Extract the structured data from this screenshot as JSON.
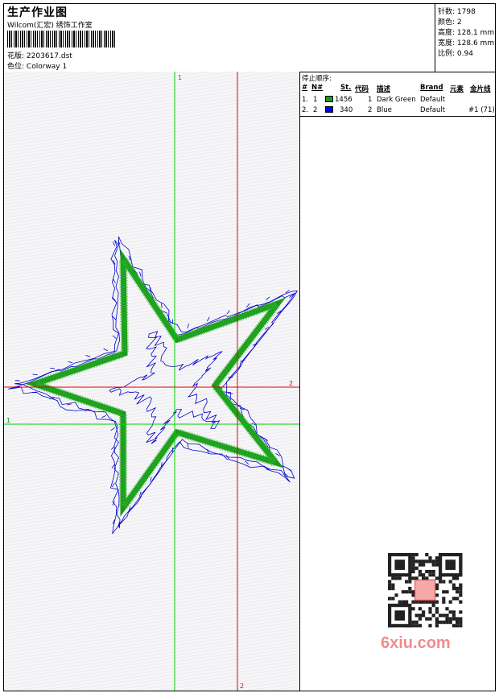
{
  "header": {
    "title": "生产作业图",
    "subtitle": "Wilcom(汇宏) 绣饰工作室",
    "design_label": "花版:",
    "design_value": "2203617.dst",
    "colorway_label": "色位:",
    "colorway_value": "Colorway 1"
  },
  "stats": [
    {
      "label": "针数:",
      "value": "1798"
    },
    {
      "label": "颜色:",
      "value": "2"
    },
    {
      "label": "高度:",
      "value": "128.1 mm"
    },
    {
      "label": "宽度:",
      "value": "128.6 mm"
    },
    {
      "label": "比例:",
      "value": "0.94"
    }
  ],
  "sequence": {
    "title": "停止顺序:",
    "headers": [
      "#",
      "N#",
      "St.",
      "代码",
      "描述",
      "Brand",
      "元素",
      "金片线"
    ],
    "rows": [
      {
        "idx": "1.",
        "n": "1",
        "color": "#1a9a1a",
        "stitches": "1456",
        "code": "1",
        "desc": "Dark Green",
        "brand": "Default",
        "element": "",
        "sequin": ""
      },
      {
        "idx": "2.",
        "n": "2",
        "color": "#0000ff",
        "stitches": "340",
        "code": "2",
        "desc": "Blue",
        "brand": "Default",
        "element": "",
        "sequin": "#1 (71)"
      }
    ]
  },
  "guides": {
    "green_label": "1",
    "red_label": "2"
  },
  "colors": {
    "green_stitch": "#1a9a1a",
    "blue_stitch": "#0000cc",
    "guide_green": "#00d000",
    "guide_red": "#e00000"
  },
  "watermark": "6xiu.com"
}
